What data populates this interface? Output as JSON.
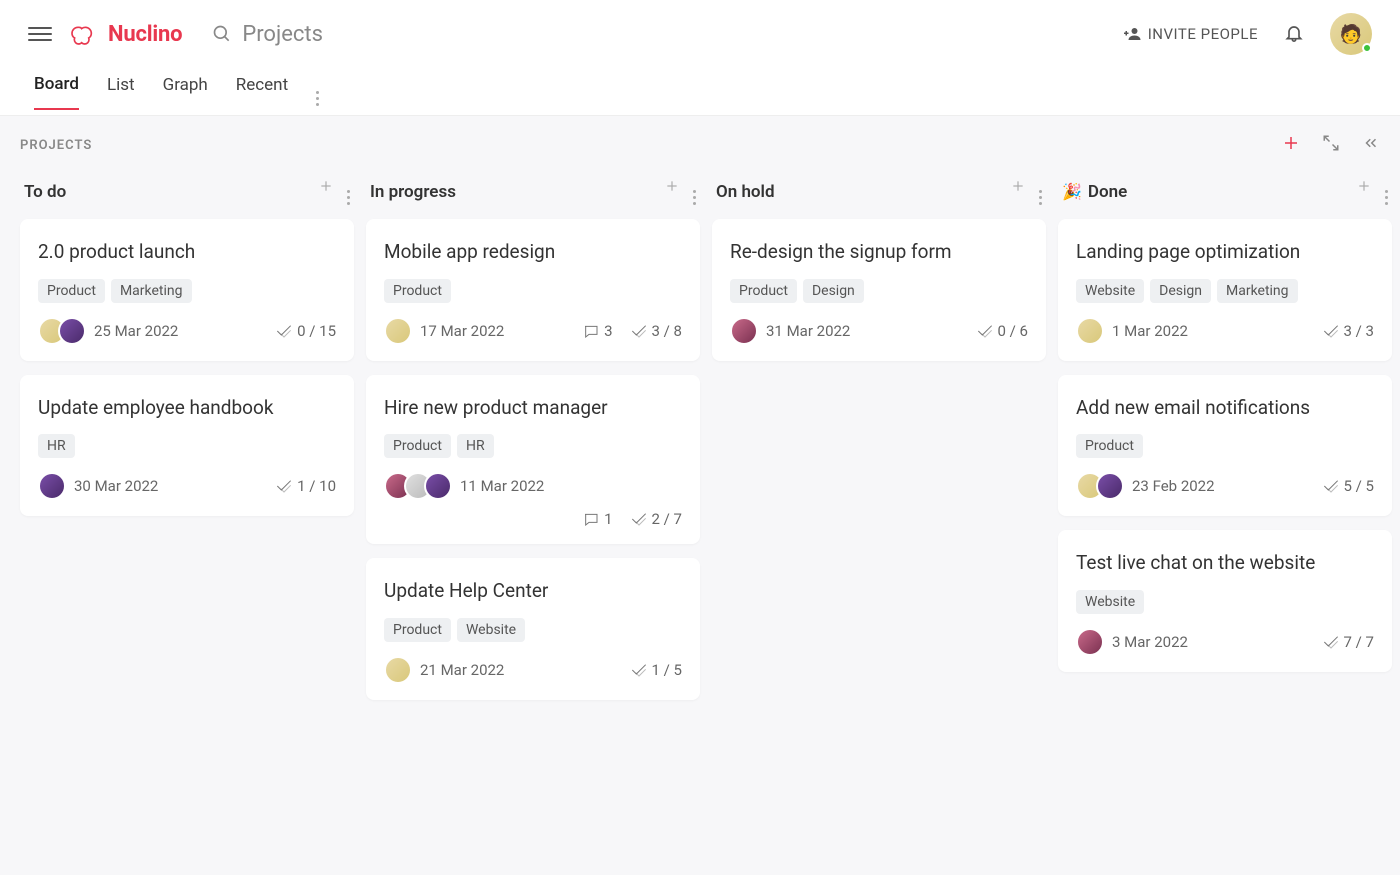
{
  "header": {
    "logo_text": "Nuclino",
    "search_placeholder": "Projects",
    "invite_label": "INVITE PEOPLE"
  },
  "tabs": [
    "Board",
    "List",
    "Graph",
    "Recent"
  ],
  "active_tab": 0,
  "board_label": "PROJECTS",
  "columns": [
    {
      "title": "To do",
      "emoji": "",
      "cards": [
        {
          "title": "2.0 product launch",
          "tags": [
            "Product",
            "Marketing"
          ],
          "avatars": [
            "c1",
            "c2"
          ],
          "date": "25 Mar 2022",
          "comments": null,
          "checklist": "0 / 15",
          "wrap_stats": false
        },
        {
          "title": "Update employee handbook",
          "tags": [
            "HR"
          ],
          "avatars": [
            "c2"
          ],
          "date": "30 Mar 2022",
          "comments": null,
          "checklist": "1 / 10",
          "wrap_stats": false
        }
      ]
    },
    {
      "title": "In progress",
      "emoji": "",
      "cards": [
        {
          "title": "Mobile app redesign",
          "tags": [
            "Product"
          ],
          "avatars": [
            "c1"
          ],
          "date": "17 Mar 2022",
          "comments": "3",
          "checklist": "3 / 8",
          "wrap_stats": false
        },
        {
          "title": "Hire new product manager",
          "tags": [
            "Product",
            "HR"
          ],
          "avatars": [
            "c3",
            "c4",
            "c2"
          ],
          "date": "11 Mar 2022",
          "comments": "1",
          "checklist": "2 / 7",
          "wrap_stats": true
        },
        {
          "title": "Update Help Center",
          "tags": [
            "Product",
            "Website"
          ],
          "avatars": [
            "c1"
          ],
          "date": "21 Mar 2022",
          "comments": null,
          "checklist": "1 / 5",
          "wrap_stats": false
        }
      ]
    },
    {
      "title": "On hold",
      "emoji": "",
      "cards": [
        {
          "title": "Re-design the signup form",
          "tags": [
            "Product",
            "Design"
          ],
          "avatars": [
            "c3"
          ],
          "date": "31 Mar 2022",
          "comments": null,
          "checklist": "0 / 6",
          "wrap_stats": false
        }
      ]
    },
    {
      "title": "Done",
      "emoji": "🎉",
      "cards": [
        {
          "title": "Landing page optimization",
          "tags": [
            "Website",
            "Design",
            "Marketing"
          ],
          "avatars": [
            "c1"
          ],
          "date": "1 Mar 2022",
          "comments": null,
          "checklist": "3 / 3",
          "wrap_stats": false
        },
        {
          "title": "Add new email notifications",
          "tags": [
            "Product"
          ],
          "avatars": [
            "c1",
            "c2"
          ],
          "date": "23 Feb 2022",
          "comments": null,
          "checklist": "5 / 5",
          "wrap_stats": false
        },
        {
          "title": "Test live chat on the website",
          "tags": [
            "Website"
          ],
          "avatars": [
            "c3"
          ],
          "date": "3 Mar 2022",
          "comments": null,
          "checklist": "7 / 7",
          "wrap_stats": false
        }
      ]
    }
  ]
}
